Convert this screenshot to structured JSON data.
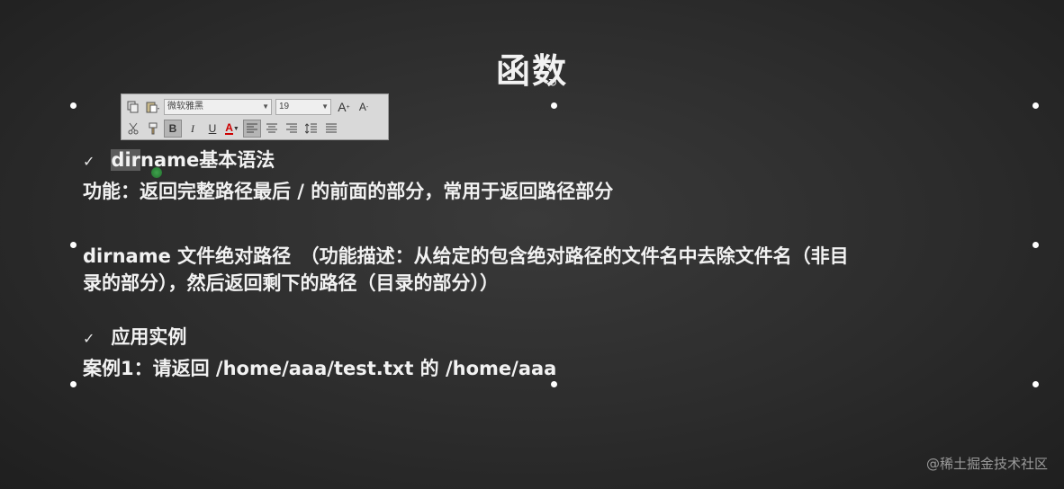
{
  "slide": {
    "title": "函数",
    "rotate_glyph": "↻",
    "section1": {
      "check": "✓",
      "heading_selected": "dir",
      "heading_rest": "name基本语法",
      "function_line": "功能：返回完整路径最后 / 的前面的部分，常用于返回路径部分"
    },
    "syntax": {
      "line1": "dirname 文件绝对路径　（功能描述：从给定的包含绝对路径的文件名中去除文件名（非目",
      "line2": "录的部分），然后返回剩下的路径（目录的部分））"
    },
    "section2": {
      "check": "✓",
      "heading": "应用实例",
      "example": "案例1：请返回 /home/aaa/test.txt 的 /home/aaa"
    }
  },
  "toolbar": {
    "font_name": "微软雅黑",
    "font_size": "19",
    "grow_label": "A",
    "shrink_label": "A",
    "bold_label": "B",
    "italic_label": "I",
    "underline_label": "U",
    "font_color_label": "A",
    "font_color": "#cc0000"
  },
  "watermark": "@稀土掘金技术社区"
}
